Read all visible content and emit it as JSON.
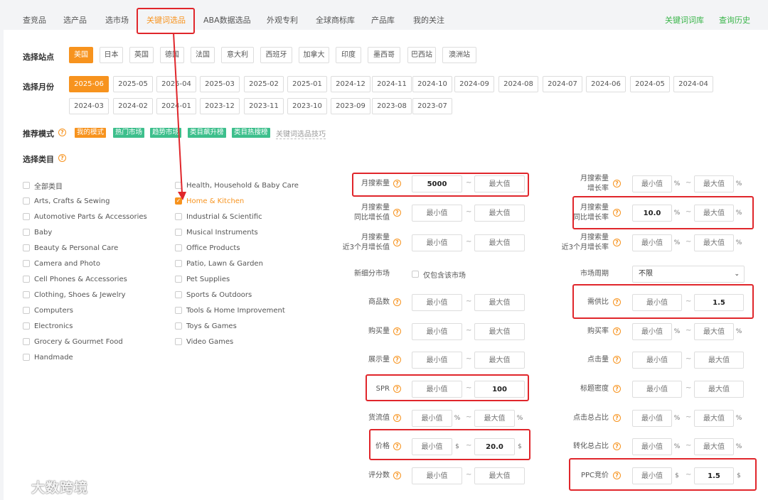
{
  "nav": {
    "tabs": [
      "查竞品",
      "选产品",
      "选市场",
      "关键词选品",
      "ABA数据选品",
      "外观专利",
      "全球商标库",
      "产品库",
      "我的关注"
    ],
    "right_links": [
      "关键词词库",
      "查询历史"
    ]
  },
  "station": {
    "label": "选择站点",
    "options": [
      "美国",
      "日本",
      "英国",
      "德国",
      "法国",
      "意大利",
      "西班牙",
      "加拿大",
      "印度",
      "墨西哥",
      "巴西站",
      "澳洲站"
    ],
    "selected": "美国"
  },
  "month": {
    "label": "选择月份",
    "options": [
      "2025-06",
      "2025-05",
      "2025-04",
      "2025-03",
      "2025-02",
      "2025-01",
      "2024-12",
      "2024-11",
      "2024-10",
      "2024-09",
      "2024-08",
      "2024-07",
      "2024-06",
      "2024-05",
      "2024-04",
      "2024-03",
      "2024-02",
      "2024-01",
      "2023-12",
      "2023-11",
      "2023-10",
      "2023-09",
      "2023-08",
      "2023-07"
    ],
    "selected": "2025-06"
  },
  "mode": {
    "label": "推荐模式",
    "tags": [
      "我的模式",
      "热门市场",
      "趋势市场",
      "类目飙升榜",
      "类目热搜榜"
    ],
    "tip_link": "关键词选品技巧"
  },
  "category": {
    "label": "选择类目",
    "col1": [
      "全部类目",
      "Arts, Crafts & Sewing",
      "Automotive Parts & Accessories",
      "Baby",
      "Beauty & Personal Care",
      "Camera and Photo",
      "Cell Phones & Accessories",
      "Clothing, Shoes & Jewelry",
      "Computers",
      "Electronics",
      "Grocery & Gourmet Food",
      "Handmade"
    ],
    "col2": [
      "Health, Household & Baby Care",
      "Home & Kitchen",
      "Industrial & Scientific",
      "Musical Instruments",
      "Office Products",
      "Patio, Lawn & Garden",
      "Pet Supplies",
      "Sports & Outdoors",
      "Tools & Home Improvement",
      "Toys & Games",
      "Video Games"
    ],
    "checked": "Home & Kitchen"
  },
  "placeholders": {
    "min": "最小值",
    "max": "最大值"
  },
  "filters_left": [
    {
      "label": "月搜索量",
      "min": "5000",
      "max": "",
      "unit": ""
    },
    {
      "label": "月搜索量\n同比增长值",
      "min": "",
      "max": "",
      "unit": ""
    },
    {
      "label": "月搜索量\n近3个月增长值",
      "min": "",
      "max": "",
      "unit": ""
    },
    {
      "label": "新细分市场",
      "checkbox_label": "仅包含该市场"
    },
    {
      "label": "商品数",
      "min": "",
      "max": "",
      "unit": ""
    },
    {
      "label": "购买量",
      "min": "",
      "max": "",
      "unit": ""
    },
    {
      "label": "展示量",
      "min": "",
      "max": "",
      "unit": ""
    },
    {
      "label": "SPR",
      "min": "",
      "max": "100",
      "unit": ""
    },
    {
      "label": "货流值",
      "min": "",
      "max": "",
      "unit": "%"
    },
    {
      "label": "价格",
      "min": "",
      "max": "20.0",
      "unit": "$"
    },
    {
      "label": "评分数",
      "min": "",
      "max": "",
      "unit": ""
    }
  ],
  "filters_right": [
    {
      "label": "月搜索量\n增长率",
      "min": "",
      "max": "",
      "unit": "%"
    },
    {
      "label": "月搜索量\n同比增长率",
      "min": "10.0",
      "max": "",
      "unit": "%"
    },
    {
      "label": "月搜索量\n近3个月增长率",
      "min": "",
      "max": "",
      "unit": "%"
    },
    {
      "label": "市场周期",
      "select_value": "不限"
    },
    {
      "label": "需供比",
      "min": "",
      "max": "1.5",
      "unit": ""
    },
    {
      "label": "购买率",
      "min": "",
      "max": "",
      "unit": "%"
    },
    {
      "label": "点击量",
      "min": "",
      "max": "",
      "unit": ""
    },
    {
      "label": "标题密度",
      "min": "",
      "max": "",
      "unit": ""
    },
    {
      "label": "点击总占比",
      "min": "",
      "max": "",
      "unit": "%"
    },
    {
      "label": "转化总占比",
      "min": "",
      "max": "",
      "unit": "%"
    },
    {
      "label": "PPC竞价",
      "min": "",
      "max": "1.5",
      "unit": "$"
    }
  ],
  "watermark": "大数跨境",
  "colors": {
    "accent": "#f7931e",
    "mode_tag": "#3dbf8c",
    "highlight": "#e0262b",
    "link": "#3ab54a"
  }
}
